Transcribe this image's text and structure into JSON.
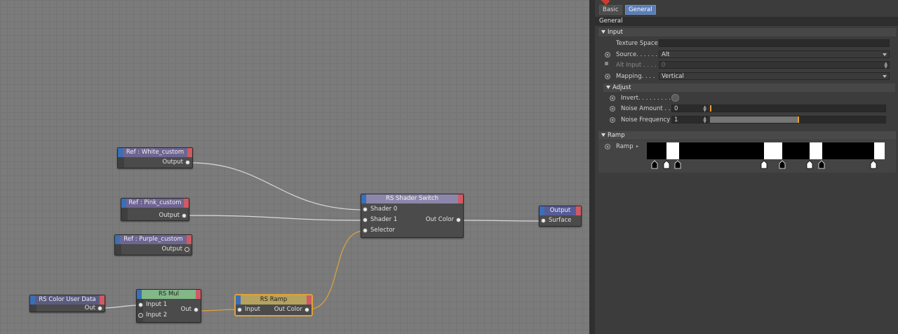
{
  "graph": {
    "nodes": {
      "white_custom": {
        "title": "Ref : White_custom",
        "output": "Output"
      },
      "pink_custom": {
        "title": "Ref : Pink_custom",
        "output": "Output"
      },
      "purple_custom": {
        "title": "Ref : Purple_custom",
        "output": "Output"
      },
      "color_user_data": {
        "title": "RS Color User Data",
        "output": "Out"
      },
      "mul": {
        "title": "RS Mul",
        "input1": "Input 1",
        "input2": "Input 2",
        "output": "Out"
      },
      "ramp": {
        "title": "RS Ramp",
        "input": "Input",
        "output": "Out Color"
      },
      "shader_switch": {
        "title": "RS Shader Switch",
        "in0": "Shader 0",
        "in1": "Shader 1",
        "in2": "Selector",
        "output": "Out Color"
      },
      "output": {
        "title": "Output",
        "input": "Surface"
      }
    }
  },
  "panel": {
    "tabs": [
      "Basic",
      "General"
    ],
    "active_tab": "General",
    "section_title": "General",
    "input_group": {
      "title": "Input",
      "texture_space_label": "Texture Space",
      "texture_space_value": "",
      "source_label": "Source. . . . . .",
      "source_value": "Alt",
      "alt_input_label": "Alt Input . . . .",
      "alt_input_value": "0",
      "mapping_label": "Mapping. . . .",
      "mapping_value": "Vertical"
    },
    "adjust_group": {
      "title": "Adjust",
      "invert_label": "Invert. . . . . . . . . .",
      "noise_amount_label": "Noise Amount . .",
      "noise_amount_value": "0",
      "noise_amount_fraction": 0.0,
      "noise_frequency_label": "Noise Frequency",
      "noise_frequency_value": "1",
      "noise_frequency_fraction": 0.5
    },
    "ramp_group": {
      "title": "Ramp",
      "ramp_label": "Ramp"
    }
  },
  "colors": {
    "canvas": "#7b7b7b",
    "node_body": "#4b4b4b",
    "header_ref": "#6e6592",
    "header_switch": "#8c86ab",
    "header_mul": "#82b887",
    "header_ramp": "#b4a25e",
    "header_output": "#575b96",
    "header_userdata": "#5b5b80",
    "wire_white": "#d8d8d8",
    "wire_orange": "#e0a23a",
    "accent": "#5a7db5"
  }
}
